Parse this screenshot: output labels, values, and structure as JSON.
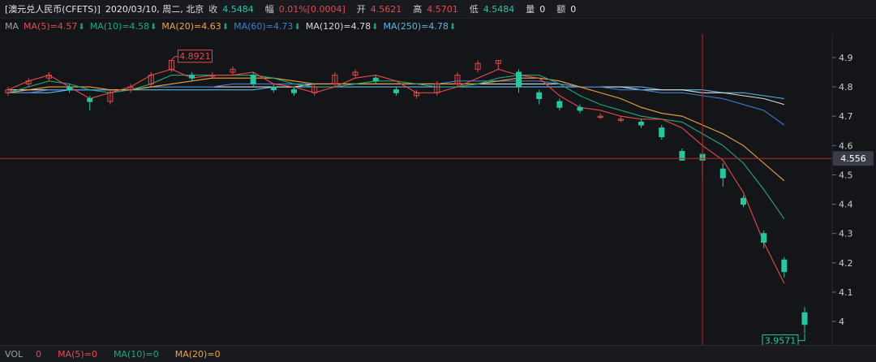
{
  "colors": {
    "up": "#e64a4a",
    "down": "#26c6a0",
    "ma5": "#e64a4a",
    "ma10": "#21a67a",
    "ma20": "#f0a43c",
    "ma60": "#3f7fd6",
    "ma120": "#d8d8d8",
    "ma250": "#5bb6e0",
    "crosshair": "#b52a2a"
  },
  "info": {
    "symbol": "[澳元兑人民币(CFETS)]",
    "datetime": "2020/03/10, 周二, 北京",
    "close_label": "收",
    "close_value": "4.5484",
    "change_label": "幅",
    "change_pct": "0.01%",
    "change_abs": "[0.0004]",
    "open_label": "开",
    "open_value": "4.5621",
    "high_label": "高",
    "high_value": "4.5701",
    "low_label": "低",
    "low_value": "4.5484",
    "vol_label": "量",
    "vol_value": "0",
    "amount_label": "额",
    "amount_value": "0"
  },
  "ma_legend": {
    "title": "MA",
    "items": [
      {
        "label": "MA(5)=4.57",
        "color": "#e64a4a"
      },
      {
        "label": "MA(10)=4.58",
        "color": "#21a67a"
      },
      {
        "label": "MA(20)=4.63",
        "color": "#f0a43c"
      },
      {
        "label": "MA(60)=4.73",
        "color": "#3f7fd6"
      },
      {
        "label": "MA(120)=4.78",
        "color": "#d8d8d8"
      },
      {
        "label": "MA(250)=4.78",
        "color": "#5bb6e0"
      }
    ]
  },
  "volume_legend": {
    "title": "VOL",
    "items": [
      {
        "label": "0",
        "color": "#e64a4a"
      },
      {
        "label": "MA(5)=0",
        "color": "#e64a4a"
      },
      {
        "label": "MA(10)=0",
        "color": "#21a67a"
      },
      {
        "label": "MA(20)=0",
        "color": "#f0a43c"
      }
    ]
  },
  "chart_data": {
    "type": "candlestick",
    "ylim": [
      3.92,
      4.98
    ],
    "yticks": [
      "4.9",
      "4.8",
      "4.7",
      "4.6",
      "4.5",
      "4.4",
      "4.3",
      "4.2",
      "4.1",
      "4"
    ],
    "crosshair_price": "4.556",
    "max_label": "4.8921",
    "min_label": "3.9571",
    "ma5": [
      4.79,
      4.82,
      4.84,
      4.8,
      4.76,
      4.78,
      4.8,
      4.84,
      4.86,
      4.83,
      4.84,
      4.84,
      4.85,
      4.81,
      4.8,
      4.78,
      4.8,
      4.83,
      4.84,
      4.82,
      4.78,
      4.78,
      4.8,
      4.83,
      4.86,
      4.84,
      4.83,
      4.77,
      4.73,
      4.72,
      4.7,
      4.69,
      4.69,
      4.66,
      4.6,
      4.55,
      4.44,
      4.27,
      4.13
    ],
    "ma10": [
      4.78,
      4.8,
      4.82,
      4.81,
      4.79,
      4.78,
      4.79,
      4.81,
      4.84,
      4.84,
      4.84,
      4.84,
      4.84,
      4.83,
      4.81,
      4.8,
      4.8,
      4.81,
      4.82,
      4.82,
      4.81,
      4.8,
      4.8,
      4.81,
      4.83,
      4.84,
      4.84,
      4.81,
      4.77,
      4.74,
      4.72,
      4.7,
      4.69,
      4.68,
      4.64,
      4.6,
      4.54,
      4.45,
      4.35
    ],
    "ma20": [
      4.78,
      4.79,
      4.8,
      4.8,
      4.8,
      4.79,
      4.79,
      4.8,
      4.81,
      4.82,
      4.83,
      4.83,
      4.83,
      4.83,
      4.82,
      4.81,
      4.81,
      4.81,
      4.81,
      4.81,
      4.81,
      4.81,
      4.81,
      4.81,
      4.82,
      4.83,
      4.83,
      4.82,
      4.8,
      4.78,
      4.76,
      4.73,
      4.71,
      4.7,
      4.67,
      4.64,
      4.6,
      4.54,
      4.48
    ],
    "ma60": [
      4.78,
      4.78,
      4.79,
      4.79,
      4.79,
      4.79,
      4.79,
      4.8,
      4.8,
      4.8,
      4.8,
      4.81,
      4.81,
      4.81,
      4.81,
      4.81,
      4.81,
      4.81,
      4.81,
      4.81,
      4.81,
      4.81,
      4.82,
      4.82,
      4.82,
      4.82,
      4.82,
      4.81,
      4.8,
      4.8,
      4.79,
      4.79,
      4.78,
      4.78,
      4.77,
      4.76,
      4.74,
      4.72,
      4.67
    ],
    "ma120": [
      4.79,
      4.79,
      4.79,
      4.79,
      4.79,
      4.79,
      4.79,
      4.8,
      4.8,
      4.8,
      4.8,
      4.8,
      4.8,
      4.8,
      4.8,
      4.81,
      4.81,
      4.81,
      4.81,
      4.81,
      4.81,
      4.81,
      4.81,
      4.81,
      4.81,
      4.81,
      4.81,
      4.81,
      4.8,
      4.8,
      4.8,
      4.79,
      4.79,
      4.79,
      4.78,
      4.78,
      4.77,
      4.76,
      4.74
    ],
    "ma250": [
      4.78,
      4.78,
      4.78,
      4.79,
      4.79,
      4.79,
      4.79,
      4.79,
      4.79,
      4.79,
      4.79,
      4.79,
      4.79,
      4.8,
      4.8,
      4.8,
      4.8,
      4.8,
      4.8,
      4.8,
      4.8,
      4.8,
      4.8,
      4.8,
      4.8,
      4.8,
      4.8,
      4.8,
      4.8,
      4.8,
      4.8,
      4.8,
      4.79,
      4.79,
      4.79,
      4.78,
      4.78,
      4.77,
      4.76
    ],
    "candles": [
      [
        4.78,
        4.79,
        4.8,
        4.77
      ],
      [
        4.81,
        4.82,
        4.83,
        4.8
      ],
      [
        4.83,
        4.84,
        4.85,
        4.82
      ],
      [
        4.8,
        4.79,
        4.81,
        4.78
      ],
      [
        4.76,
        4.75,
        4.77,
        4.72
      ],
      [
        4.75,
        4.78,
        4.79,
        4.74
      ],
      [
        4.79,
        4.8,
        4.81,
        4.78
      ],
      [
        4.81,
        4.84,
        4.85,
        4.8
      ],
      [
        4.86,
        4.89,
        4.89,
        4.85
      ],
      [
        4.84,
        4.83,
        4.85,
        4.82
      ],
      [
        4.84,
        4.84,
        4.85,
        4.83
      ],
      [
        4.85,
        4.86,
        4.87,
        4.84
      ],
      [
        4.84,
        4.81,
        4.85,
        4.8
      ],
      [
        4.8,
        4.79,
        4.81,
        4.78
      ],
      [
        4.79,
        4.78,
        4.8,
        4.77
      ],
      [
        4.78,
        4.8,
        4.81,
        4.77
      ],
      [
        4.81,
        4.84,
        4.85,
        4.8
      ],
      [
        4.84,
        4.85,
        4.86,
        4.83
      ],
      [
        4.83,
        4.82,
        4.84,
        4.81
      ],
      [
        4.79,
        4.78,
        4.8,
        4.77
      ],
      [
        4.77,
        4.78,
        4.79,
        4.76
      ],
      [
        4.78,
        4.81,
        4.82,
        4.77
      ],
      [
        4.81,
        4.84,
        4.85,
        4.8
      ],
      [
        4.86,
        4.88,
        4.89,
        4.85
      ],
      [
        4.88,
        4.89,
        4.89,
        4.86
      ],
      [
        4.85,
        4.8,
        4.86,
        4.78
      ],
      [
        4.78,
        4.76,
        4.79,
        4.74
      ],
      [
        4.75,
        4.73,
        4.76,
        4.72
      ],
      [
        4.73,
        4.72,
        4.74,
        4.71
      ],
      [
        4.7,
        4.7,
        4.71,
        4.69
      ],
      [
        4.69,
        4.69,
        4.7,
        4.68
      ],
      [
        4.68,
        4.67,
        4.69,
        4.66
      ],
      [
        4.66,
        4.63,
        4.67,
        4.62
      ],
      [
        4.58,
        4.55,
        4.59,
        4.55
      ],
      [
        4.57,
        4.55,
        4.57,
        4.49
      ],
      [
        4.52,
        4.49,
        4.54,
        4.46
      ],
      [
        4.42,
        4.4,
        4.43,
        4.39
      ],
      [
        4.3,
        4.27,
        4.31,
        4.25
      ],
      [
        4.21,
        4.17,
        4.22,
        4.15
      ],
      [
        4.03,
        3.99,
        4.05,
        3.96
      ]
    ]
  }
}
